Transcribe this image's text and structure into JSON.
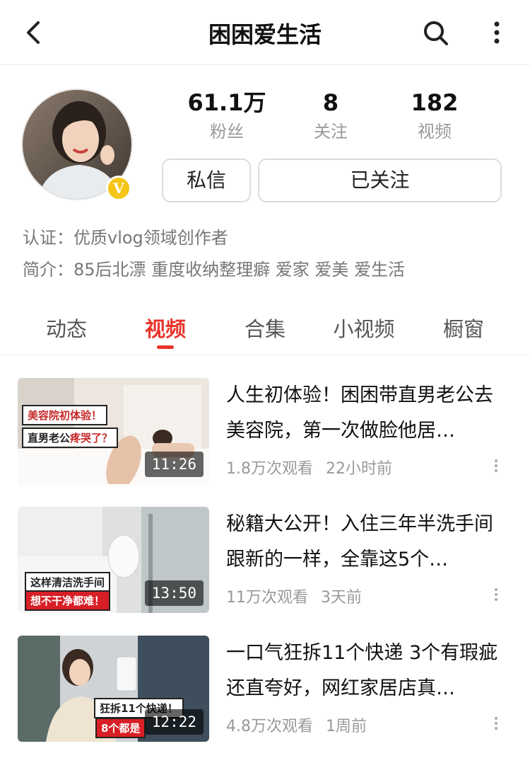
{
  "header": {
    "title": "困困爱生活",
    "back_icon": "back-arrow-icon",
    "search_icon": "search-icon",
    "more_icon": "more-vertical-icon"
  },
  "profile": {
    "verified_badge": "V",
    "stats": [
      {
        "value": "61.1万",
        "label": "粉丝"
      },
      {
        "value": "8",
        "label": "关注"
      },
      {
        "value": "182",
        "label": "视频"
      }
    ],
    "message_button": "私信",
    "follow_button": "已关注",
    "certification": "认证：优质vlog领域创作者",
    "intro": "简介：85后北漂 重度收纳整理癖 爱家 爱美 爱生活"
  },
  "tabs": [
    {
      "label": "动态"
    },
    {
      "label": "视频"
    },
    {
      "label": "合集"
    },
    {
      "label": "小视频"
    },
    {
      "label": "橱窗"
    }
  ],
  "active_tab": "视频",
  "accent_color": "#e8332a",
  "videos": [
    {
      "title": "人生初体验！困困带直男老公去美容院，第一次做脸他居…",
      "views": "1.8万次观看",
      "time": "22小时前",
      "duration": "11:26",
      "thumb_text_1": "美容院初体验！",
      "thumb_text_2a": "直男老公",
      "thumb_text_2b": "疼哭了？"
    },
    {
      "title": "秘籍大公开！入住三年半洗手间跟新的一样，全靠这5个…",
      "views": "11万次观看",
      "time": "3天前",
      "duration": "13:50",
      "thumb_text_1": "这样清洁洗手间",
      "thumb_text_2": "想不干净都难！"
    },
    {
      "title": "一口气狂拆11个快递 3个有瑕疵还直夸好，网红家居店真…",
      "views": "4.8万次观看",
      "time": "1周前",
      "duration": "12:22",
      "thumb_text_1": "狂拆11个快递！",
      "thumb_text_2": "8个都是"
    }
  ]
}
